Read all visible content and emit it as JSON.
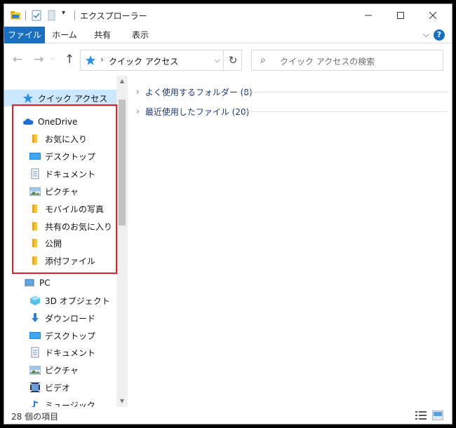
{
  "window": {
    "title": "エクスプローラー",
    "minimize_icon": "minimize-icon",
    "maximize_icon": "maximize-icon",
    "close_icon": "close-icon"
  },
  "ribbon": {
    "tabs": [
      {
        "label": "ファイル"
      },
      {
        "label": "ホーム"
      },
      {
        "label": "共有"
      },
      {
        "label": "表示"
      }
    ],
    "help_label": "?",
    "accent": "#1a6fc1"
  },
  "address": {
    "path": "クイック アクセス",
    "search_placeholder": "クイック アクセスの検索"
  },
  "nav": {
    "quick_access": "クイック アクセス",
    "onedrive": {
      "label": "OneDrive",
      "items": [
        {
          "label": "お気に入り",
          "icon": "folder-icon"
        },
        {
          "label": "デスクトップ",
          "icon": "desktop-icon"
        },
        {
          "label": "ドキュメント",
          "icon": "documents-icon"
        },
        {
          "label": "ピクチャ",
          "icon": "pictures-icon"
        },
        {
          "label": "モバイルの写真",
          "icon": "folder-icon"
        },
        {
          "label": "共有のお気に入り",
          "icon": "folder-icon"
        },
        {
          "label": "公開",
          "icon": "folder-icon"
        },
        {
          "label": "添付ファイル",
          "icon": "folder-icon"
        }
      ]
    },
    "pc": {
      "label": "PC",
      "items": [
        {
          "label": "3D オブジェクト",
          "icon": "3d-objects-icon"
        },
        {
          "label": "ダウンロード",
          "icon": "download-icon"
        },
        {
          "label": "デスクトップ",
          "icon": "desktop-icon"
        },
        {
          "label": "ドキュメント",
          "icon": "documents-icon"
        },
        {
          "label": "ピクチャ",
          "icon": "pictures-icon"
        },
        {
          "label": "ビデオ",
          "icon": "video-icon"
        },
        {
          "label": "ミュージック",
          "icon": "music-icon"
        }
      ]
    },
    "highlight_color": "#e0202a"
  },
  "content": {
    "groups": [
      {
        "label": "よく使用するフォルダー (8)"
      },
      {
        "label": "最近使用したファイル (20)"
      }
    ]
  },
  "status": {
    "item_count": "28 個の項目"
  }
}
